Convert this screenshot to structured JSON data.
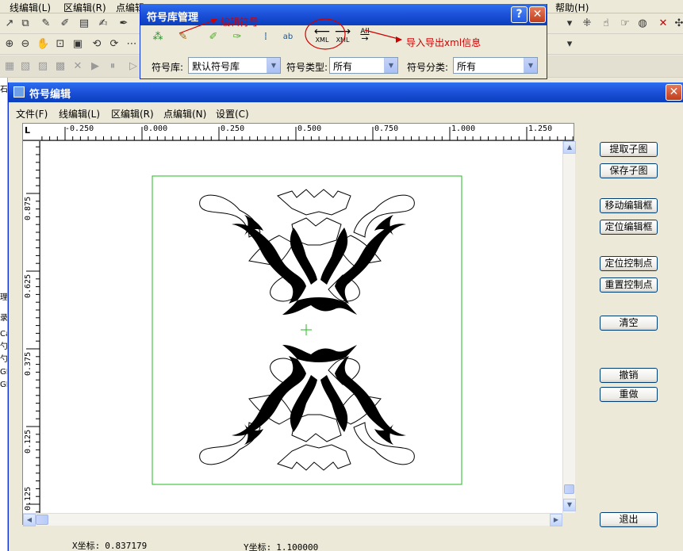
{
  "main_menu": [
    "线编辑(L)",
    "区编辑(R)",
    "点编辑",
    "帮助(H)"
  ],
  "library_window": {
    "title": "符号库管理",
    "library_label": "符号库:",
    "library_value": "默认符号库",
    "type_label": "符号类型:",
    "type_value": "所有",
    "category_label": "符号分类:",
    "category_value": "所有",
    "xml_label": "XML",
    "all_label": "All"
  },
  "annotations": {
    "edit_symbol": "编辑符号",
    "import_export": "导入导出xml信息"
  },
  "left_strip": [
    "石",
    "理",
    "录",
    "Ca",
    "勺",
    "勺",
    "GI",
    "GI"
  ],
  "editor": {
    "title": "符号编辑",
    "menu": [
      "文件(F)",
      "线编辑(L)",
      "区编辑(R)",
      "点编辑(N)",
      "设置(C)"
    ],
    "ruler_corner": "L",
    "ruler_top": [
      "-0.250",
      "0.000",
      "0.250",
      "0.500",
      "0.750",
      "1.000",
      "1.250"
    ],
    "ruler_left": [
      "0.875",
      "0.625",
      "0.375",
      "0.125",
      "0.125"
    ],
    "buttons": {
      "extract": "提取子图",
      "save": "保存子图",
      "move_frame": "移动编辑框",
      "locate_frame": "定位编辑框",
      "locate_ctrl": "定位控制点",
      "reset_ctrl": "重置控制点",
      "clear": "清空",
      "undo": "撤销",
      "redo": "重做",
      "exit": "退出"
    },
    "status": {
      "x_label": "X坐标:",
      "x_value": "0.837179",
      "y_label": "Y坐标:",
      "y_value": "1.100000"
    }
  },
  "colors": {
    "titlebar": "#1c50d8",
    "annotation": "#d00000",
    "frame": "#22bb22"
  }
}
